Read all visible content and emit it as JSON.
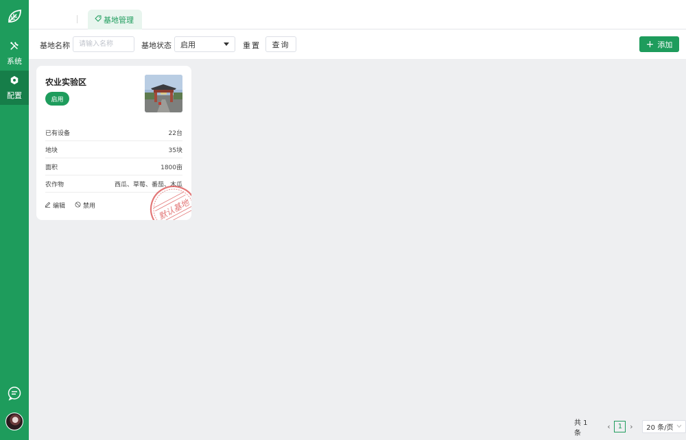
{
  "sidebar": {
    "logo_icon": "leaf-icon",
    "items": [
      {
        "label": "系统",
        "icon": "tools-icon",
        "active": false
      },
      {
        "label": "配置",
        "icon": "hexagon-gear-icon",
        "active": true
      }
    ],
    "chat_icon": "chat-icon",
    "avatar_icon": "avatar"
  },
  "tabs": [
    {
      "label": "基地管理",
      "icon": "tag-icon",
      "active": true
    }
  ],
  "filters": {
    "name_label": "基地名称",
    "name_placeholder": "请输入名称",
    "name_value": "",
    "status_label": "基地状态",
    "status_value": "启用",
    "reset_label": "重置",
    "query_label": "查询",
    "add_label": "添加"
  },
  "cards": [
    {
      "title": "农业实验区",
      "status": "启用",
      "rows": [
        {
          "label": "已有设备",
          "value": "22台"
        },
        {
          "label": "地块",
          "value": "35块"
        },
        {
          "label": "面积",
          "value": "1800亩"
        },
        {
          "label": "农作物",
          "value": "西瓜、草莓、番茄、木瓜"
        }
      ],
      "actions": [
        {
          "label": "编辑",
          "icon": "edit-icon"
        },
        {
          "label": "禁用",
          "icon": "ban-icon"
        }
      ],
      "stamp_text": "默认基地"
    }
  ],
  "pagination": {
    "total": "共 1 条",
    "current_page": "1",
    "page_size": "20 条/页"
  },
  "colors": {
    "primary": "#1e9c5c",
    "sidebar": "#1e9c5c",
    "sidebar_active": "#167e49",
    "background": "#eeeff1",
    "stamp": "#d94a4a"
  }
}
